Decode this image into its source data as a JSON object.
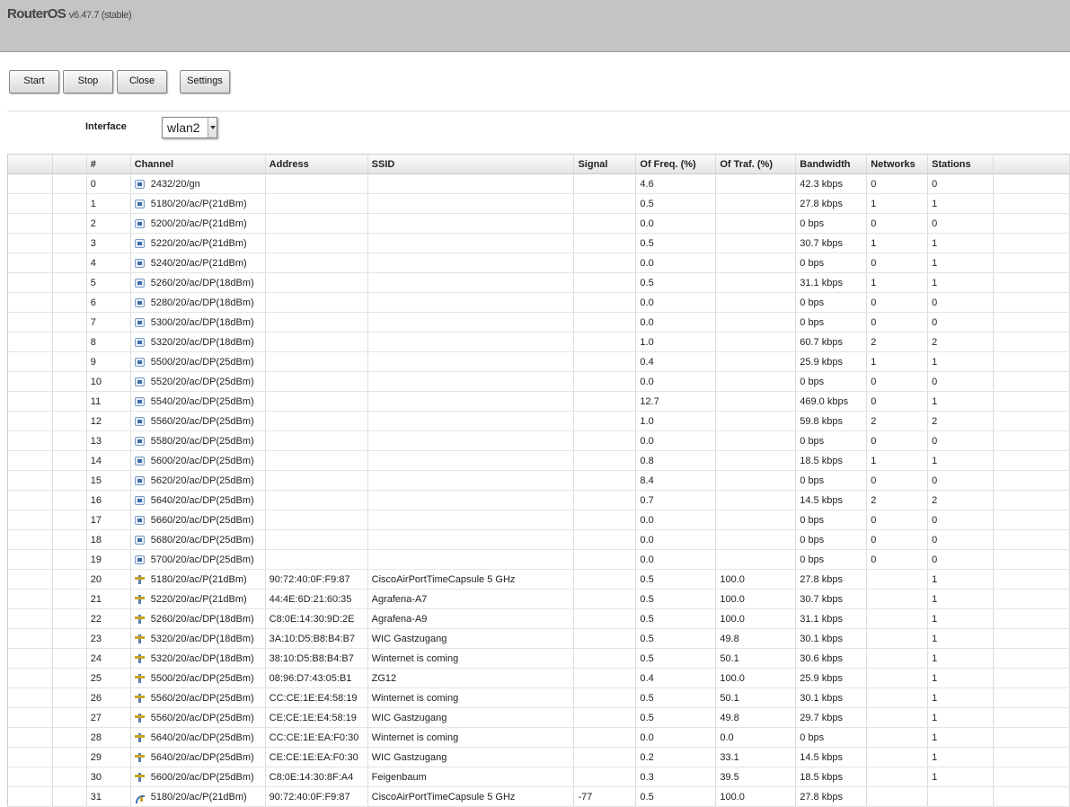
{
  "app": {
    "name": "RouterOS",
    "version": "v6.47.7 (stable)"
  },
  "toolbar": {
    "start": "Start",
    "stop": "Stop",
    "close": "Close",
    "settings": "Settings"
  },
  "interface": {
    "label": "Interface",
    "value": "wlan2"
  },
  "table": {
    "columns": [
      "",
      "",
      "#",
      "Channel",
      "Address",
      "SSID",
      "Signal",
      "Of Freq. (%)",
      "Of Traf. (%)",
      "Bandwidth",
      "Networks",
      "Stations",
      ""
    ],
    "rows": [
      {
        "n": "0",
        "icon": "scan-icon",
        "channel": "2432/20/gn",
        "address": "",
        "ssid": "",
        "signal": "",
        "freq": "4.6",
        "traf": "",
        "bw": "42.3 kbps",
        "networks": "0",
        "stations": "0"
      },
      {
        "n": "1",
        "icon": "scan-icon",
        "channel": "5180/20/ac/P(21dBm)",
        "address": "",
        "ssid": "",
        "signal": "",
        "freq": "0.5",
        "traf": "",
        "bw": "27.8 kbps",
        "networks": "1",
        "stations": "1"
      },
      {
        "n": "2",
        "icon": "scan-icon",
        "channel": "5200/20/ac/P(21dBm)",
        "address": "",
        "ssid": "",
        "signal": "",
        "freq": "0.0",
        "traf": "",
        "bw": "0 bps",
        "networks": "0",
        "stations": "0"
      },
      {
        "n": "3",
        "icon": "scan-icon",
        "channel": "5220/20/ac/P(21dBm)",
        "address": "",
        "ssid": "",
        "signal": "",
        "freq": "0.5",
        "traf": "",
        "bw": "30.7 kbps",
        "networks": "1",
        "stations": "1"
      },
      {
        "n": "4",
        "icon": "scan-icon",
        "channel": "5240/20/ac/P(21dBm)",
        "address": "",
        "ssid": "",
        "signal": "",
        "freq": "0.0",
        "traf": "",
        "bw": "0 bps",
        "networks": "0",
        "stations": "1"
      },
      {
        "n": "5",
        "icon": "scan-icon",
        "channel": "5260/20/ac/DP(18dBm)",
        "address": "",
        "ssid": "",
        "signal": "",
        "freq": "0.5",
        "traf": "",
        "bw": "31.1 kbps",
        "networks": "1",
        "stations": "1"
      },
      {
        "n": "6",
        "icon": "scan-icon",
        "channel": "5280/20/ac/DP(18dBm)",
        "address": "",
        "ssid": "",
        "signal": "",
        "freq": "0.0",
        "traf": "",
        "bw": "0 bps",
        "networks": "0",
        "stations": "0"
      },
      {
        "n": "7",
        "icon": "scan-icon",
        "channel": "5300/20/ac/DP(18dBm)",
        "address": "",
        "ssid": "",
        "signal": "",
        "freq": "0.0",
        "traf": "",
        "bw": "0 bps",
        "networks": "0",
        "stations": "0"
      },
      {
        "n": "8",
        "icon": "scan-icon",
        "channel": "5320/20/ac/DP(18dBm)",
        "address": "",
        "ssid": "",
        "signal": "",
        "freq": "1.0",
        "traf": "",
        "bw": "60.7 kbps",
        "networks": "2",
        "stations": "2"
      },
      {
        "n": "9",
        "icon": "scan-icon",
        "channel": "5500/20/ac/DP(25dBm)",
        "address": "",
        "ssid": "",
        "signal": "",
        "freq": "0.4",
        "traf": "",
        "bw": "25.9 kbps",
        "networks": "1",
        "stations": "1"
      },
      {
        "n": "10",
        "icon": "scan-icon",
        "channel": "5520/20/ac/DP(25dBm)",
        "address": "",
        "ssid": "",
        "signal": "",
        "freq": "0.0",
        "traf": "",
        "bw": "0 bps",
        "networks": "0",
        "stations": "0"
      },
      {
        "n": "11",
        "icon": "scan-icon",
        "channel": "5540/20/ac/DP(25dBm)",
        "address": "",
        "ssid": "",
        "signal": "",
        "freq": "12.7",
        "traf": "",
        "bw": "469.0 kbps",
        "networks": "0",
        "stations": "1"
      },
      {
        "n": "12",
        "icon": "scan-icon",
        "channel": "5560/20/ac/DP(25dBm)",
        "address": "",
        "ssid": "",
        "signal": "",
        "freq": "1.0",
        "traf": "",
        "bw": "59.8 kbps",
        "networks": "2",
        "stations": "2"
      },
      {
        "n": "13",
        "icon": "scan-icon",
        "channel": "5580/20/ac/DP(25dBm)",
        "address": "",
        "ssid": "",
        "signal": "",
        "freq": "0.0",
        "traf": "",
        "bw": "0 bps",
        "networks": "0",
        "stations": "0"
      },
      {
        "n": "14",
        "icon": "scan-icon",
        "channel": "5600/20/ac/DP(25dBm)",
        "address": "",
        "ssid": "",
        "signal": "",
        "freq": "0.8",
        "traf": "",
        "bw": "18.5 kbps",
        "networks": "1",
        "stations": "1"
      },
      {
        "n": "15",
        "icon": "scan-icon",
        "channel": "5620/20/ac/DP(25dBm)",
        "address": "",
        "ssid": "",
        "signal": "",
        "freq": "8.4",
        "traf": "",
        "bw": "0 bps",
        "networks": "0",
        "stations": "0"
      },
      {
        "n": "16",
        "icon": "scan-icon",
        "channel": "5640/20/ac/DP(25dBm)",
        "address": "",
        "ssid": "",
        "signal": "",
        "freq": "0.7",
        "traf": "",
        "bw": "14.5 kbps",
        "networks": "2",
        "stations": "2"
      },
      {
        "n": "17",
        "icon": "scan-icon",
        "channel": "5660/20/ac/DP(25dBm)",
        "address": "",
        "ssid": "",
        "signal": "",
        "freq": "0.0",
        "traf": "",
        "bw": "0 bps",
        "networks": "0",
        "stations": "0"
      },
      {
        "n": "18",
        "icon": "scan-icon",
        "channel": "5680/20/ac/DP(25dBm)",
        "address": "",
        "ssid": "",
        "signal": "",
        "freq": "0.0",
        "traf": "",
        "bw": "0 bps",
        "networks": "0",
        "stations": "0"
      },
      {
        "n": "19",
        "icon": "scan-icon",
        "channel": "5700/20/ac/DP(25dBm)",
        "address": "",
        "ssid": "",
        "signal": "",
        "freq": "0.0",
        "traf": "",
        "bw": "0 bps",
        "networks": "0",
        "stations": "0"
      },
      {
        "n": "20",
        "icon": "ap-icon",
        "channel": "5180/20/ac/P(21dBm)",
        "address": "90:72:40:0F:F9:87",
        "ssid": "CiscoAirPortTimeCapsule 5 GHz",
        "signal": "",
        "freq": "0.5",
        "traf": "100.0",
        "bw": "27.8 kbps",
        "networks": "",
        "stations": "1"
      },
      {
        "n": "21",
        "icon": "ap-icon",
        "channel": "5220/20/ac/P(21dBm)",
        "address": "44:4E:6D:21:60:35",
        "ssid": "Agrafena-A7",
        "signal": "",
        "freq": "0.5",
        "traf": "100.0",
        "bw": "30.7 kbps",
        "networks": "",
        "stations": "1"
      },
      {
        "n": "22",
        "icon": "ap-icon",
        "channel": "5260/20/ac/DP(18dBm)",
        "address": "C8:0E:14:30:9D:2E",
        "ssid": "Agrafena-A9",
        "signal": "",
        "freq": "0.5",
        "traf": "100.0",
        "bw": "31.1 kbps",
        "networks": "",
        "stations": "1"
      },
      {
        "n": "23",
        "icon": "ap-icon",
        "channel": "5320/20/ac/DP(18dBm)",
        "address": "3A:10:D5:B8:B4:B7",
        "ssid": "WIC Gastzugang",
        "signal": "",
        "freq": "0.5",
        "traf": "49.8",
        "bw": "30.1 kbps",
        "networks": "",
        "stations": "1"
      },
      {
        "n": "24",
        "icon": "ap-icon",
        "channel": "5320/20/ac/DP(18dBm)",
        "address": "38:10:D5:B8:B4:B7",
        "ssid": "Winternet is coming",
        "signal": "",
        "freq": "0.5",
        "traf": "50.1",
        "bw": "30.6 kbps",
        "networks": "",
        "stations": "1"
      },
      {
        "n": "25",
        "icon": "ap-icon",
        "channel": "5500/20/ac/DP(25dBm)",
        "address": "08:96:D7:43:05:B1",
        "ssid": "ZG12",
        "signal": "",
        "freq": "0.4",
        "traf": "100.0",
        "bw": "25.9 kbps",
        "networks": "",
        "stations": "1"
      },
      {
        "n": "26",
        "icon": "ap-icon",
        "channel": "5560/20/ac/DP(25dBm)",
        "address": "CC:CE:1E:E4:58:19",
        "ssid": "Winternet is coming",
        "signal": "",
        "freq": "0.5",
        "traf": "50.1",
        "bw": "30.1 kbps",
        "networks": "",
        "stations": "1"
      },
      {
        "n": "27",
        "icon": "ap-icon",
        "channel": "5560/20/ac/DP(25dBm)",
        "address": "CE:CE:1E:E4:58:19",
        "ssid": "WIC Gastzugang",
        "signal": "",
        "freq": "0.5",
        "traf": "49.8",
        "bw": "29.7 kbps",
        "networks": "",
        "stations": "1"
      },
      {
        "n": "28",
        "icon": "ap-icon",
        "channel": "5640/20/ac/DP(25dBm)",
        "address": "CC:CE:1E:EA:F0:30",
        "ssid": "Winternet is coming",
        "signal": "",
        "freq": "0.0",
        "traf": "0.0",
        "bw": "0 bps",
        "networks": "",
        "stations": "1"
      },
      {
        "n": "29",
        "icon": "ap-icon",
        "channel": "5640/20/ac/DP(25dBm)",
        "address": "CE:CE:1E:EA:F0:30",
        "ssid": "WIC Gastzugang",
        "signal": "",
        "freq": "0.2",
        "traf": "33.1",
        "bw": "14.5 kbps",
        "networks": "",
        "stations": "1"
      },
      {
        "n": "30",
        "icon": "ap-icon",
        "channel": "5600/20/ac/DP(25dBm)",
        "address": "C8:0E:14:30:8F:A4",
        "ssid": "Feigenbaum",
        "signal": "",
        "freq": "0.3",
        "traf": "39.5",
        "bw": "18.5 kbps",
        "networks": "",
        "stations": "1"
      },
      {
        "n": "31",
        "icon": "signal-icon",
        "channel": "5180/20/ac/P(21dBm)",
        "address": "90:72:40:0F:F9:87",
        "ssid": "CiscoAirPortTimeCapsule 5 GHz",
        "signal": "-77",
        "freq": "0.5",
        "traf": "100.0",
        "bw": "27.8 kbps",
        "networks": "",
        "stations": ""
      }
    ]
  }
}
